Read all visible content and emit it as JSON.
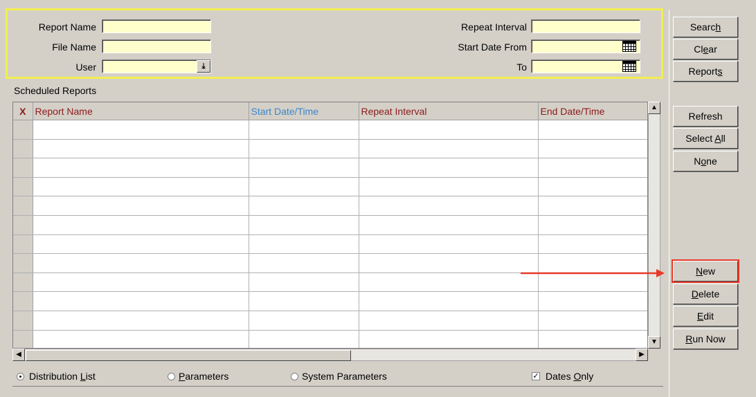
{
  "search": {
    "report_name_label": "Report Name",
    "report_name_value": "",
    "file_name_label": "File Name",
    "file_name_value": "",
    "user_label": "User",
    "user_value": "",
    "repeat_interval_label": "Repeat Interval",
    "repeat_interval_value": "",
    "start_date_from_label": "Start Date From",
    "start_date_from_value": "",
    "to_label": "To",
    "to_value": ""
  },
  "grid": {
    "section_title": "Scheduled Reports",
    "columns": [
      {
        "label": "X",
        "color": "#8b1a1a"
      },
      {
        "label": "Report Name",
        "color": "#8b1a1a"
      },
      {
        "label": "Start Date/Time",
        "color": "#3b86c9"
      },
      {
        "label": "Repeat Interval",
        "color": "#8b1a1a"
      },
      {
        "label": "End Date/Time",
        "color": "#8b1a1a"
      }
    ],
    "row_count": 12
  },
  "buttons": {
    "search": {
      "pre": "Searc",
      "key": "h",
      "post": ""
    },
    "clear": {
      "pre": "Cl",
      "key": "e",
      "post": "ar"
    },
    "reports": {
      "pre": "Report",
      "key": "s",
      "post": ""
    },
    "refresh": {
      "pre": "Refresh",
      "key": "",
      "post": ""
    },
    "select_all": {
      "pre": "Select ",
      "key": "A",
      "post": "ll"
    },
    "none": {
      "pre": "N",
      "key": "o",
      "post": "ne"
    },
    "new": {
      "pre": "",
      "key": "N",
      "post": "ew"
    },
    "delete": {
      "pre": "",
      "key": "D",
      "post": "elete"
    },
    "edit": {
      "pre": "",
      "key": "E",
      "post": "dit"
    },
    "run_now": {
      "pre": "",
      "key": "R",
      "post": "un Now"
    }
  },
  "options": {
    "distribution_list": {
      "pre": "Distribution ",
      "key": "L",
      "post": "ist",
      "selected": true
    },
    "parameters": {
      "pre": "",
      "key": "P",
      "post": "arameters",
      "selected": false
    },
    "system_parameters": {
      "pre": "System Parameters",
      "key": "",
      "post": "",
      "selected": false
    },
    "dates_only": {
      "pre": "Dates ",
      "key": "O",
      "post": "nly",
      "checked": true
    }
  },
  "colors": {
    "annotation_arrow": "#e8392a",
    "search_panel_border": "#f2ee50",
    "field_background": "#ffffcc"
  }
}
